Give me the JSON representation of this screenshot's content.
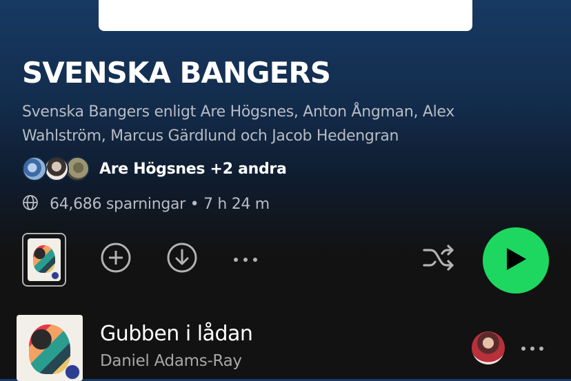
{
  "playlist": {
    "title": "SVENSKA BANGERS",
    "description": "Svenska Bangers enligt Are Högsnes, Anton Ångman, Alex Wahlström, Marcus Gärdlund och Jacob Hedengran",
    "owners_label": "Are Högsnes +2 andra",
    "meta": "64,686 sparningar • 7 h 24 m"
  },
  "icons": {
    "globe": "globe-icon",
    "add": "add-circle-icon",
    "download": "download-icon",
    "more": "more-icon",
    "shuffle": "shuffle-icon",
    "play": "play-icon"
  },
  "track": {
    "title": "Gubben i lådan",
    "artist": "Daniel Adams-Ray"
  },
  "colors": {
    "accent": "#1ed760",
    "background": "#121212",
    "header_gradient_top": "#173a63"
  }
}
